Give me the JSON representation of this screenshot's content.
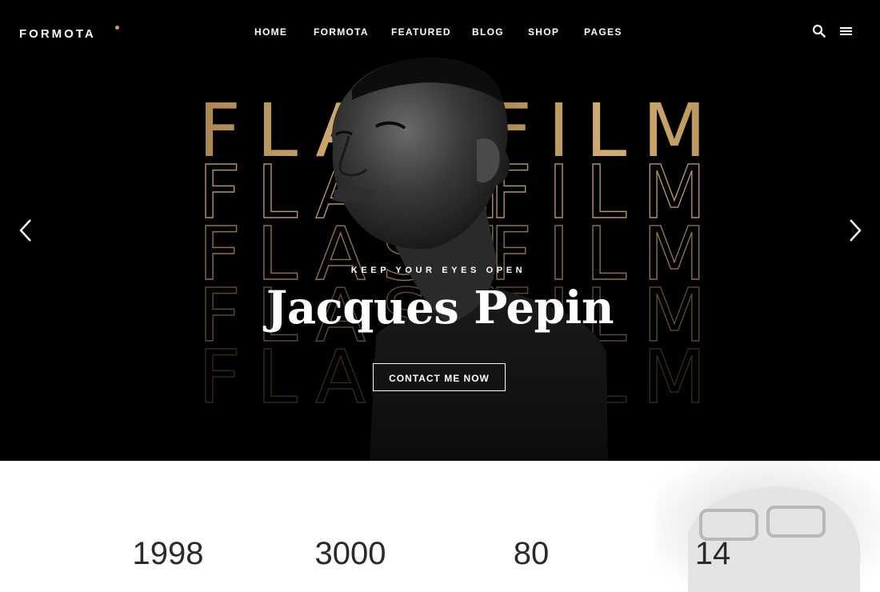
{
  "brand": {
    "name": "FORMOTA",
    "accent_color": "#c9a26a"
  },
  "nav": {
    "items": [
      "HOME",
      "FORMOTA",
      "FEATURED",
      "BLOG",
      "SHOP",
      "PAGES"
    ]
  },
  "header_icons": [
    "search-icon",
    "menu-icon"
  ],
  "hero": {
    "background_words_left": "FLASH",
    "background_words_right": "FILM",
    "subtitle": "KEEP YOUR EYES OPEN",
    "title": "Jacques Pepin",
    "cta_label": "CONTACT ME NOW",
    "gold_color": "#c9a26a"
  },
  "stats": [
    {
      "number": "1998"
    },
    {
      "number": "3000"
    },
    {
      "number": "80"
    },
    {
      "number": "14"
    }
  ]
}
